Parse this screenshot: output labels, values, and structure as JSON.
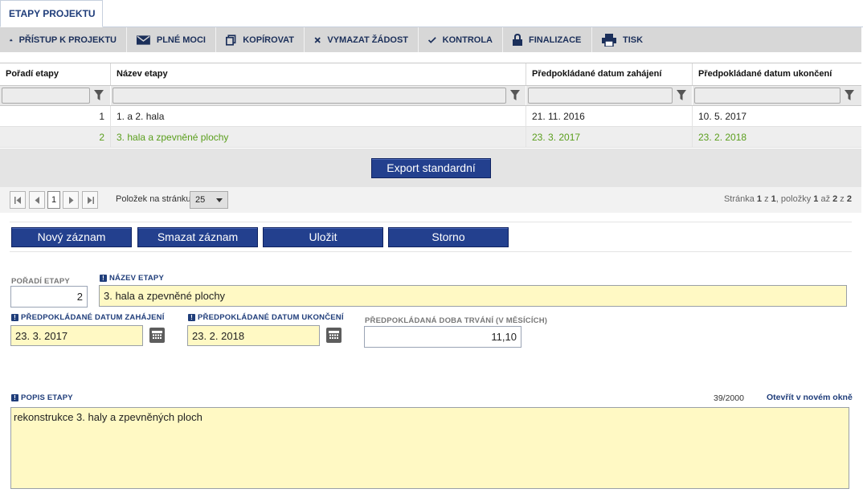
{
  "tab": {
    "title": "ETAPY PROJEKTU"
  },
  "toolbar": {
    "items": [
      {
        "label": "PŘÍSTUP K PROJEKTU",
        "icon": "people-icon"
      },
      {
        "label": "PLNÉ MOCI",
        "icon": "envelope-icon"
      },
      {
        "label": "KOPÍROVAT",
        "icon": "copy-icon"
      },
      {
        "label": "VYMAZAT ŽÁDOST",
        "icon": "cross-icon"
      },
      {
        "label": "KONTROLA",
        "icon": "check-icon"
      },
      {
        "label": "FINALIZACE",
        "icon": "lock-icon"
      },
      {
        "label": "TISK",
        "icon": "printer-icon"
      }
    ]
  },
  "grid": {
    "columns": [
      "Pořadí etapy",
      "Název etapy",
      "Předpokládané datum zahájení",
      "Předpokládané datum ukončení"
    ],
    "rows": [
      {
        "order": "1",
        "name": "1. a 2. hala",
        "start": "21. 11. 2016",
        "end": "10. 5. 2017"
      },
      {
        "order": "2",
        "name": "3. hala a zpevněné plochy",
        "start": "23. 3. 2017",
        "end": "23. 2. 2018"
      }
    ],
    "selected_color": "#5a9e1c",
    "export_label": "Export standardní"
  },
  "pager": {
    "current_page": "1",
    "page_size_label": "Položek na stránku",
    "page_size": "25",
    "info": {
      "prefix": "Stránka ",
      "page": "1",
      "of": " z ",
      "pages": "1",
      "items": ", položky ",
      "from": "1",
      "to_text": " až ",
      "to": "2",
      "z2": " z ",
      "total": "2"
    }
  },
  "actions": {
    "new": "Nový záznam",
    "delete": "Smazat záznam",
    "save": "Uložit",
    "cancel": "Storno"
  },
  "form": {
    "order_label": "POŘADÍ ETAPY",
    "order_value": "2",
    "name_label": "NÁZEV ETAPY",
    "name_value": "3. hala a zpevněné plochy",
    "start_label": "PŘEDPOKLÁDANÉ DATUM ZAHÁJENÍ",
    "start_value": "23. 3. 2017",
    "end_label": "PŘEDPOKLÁDANÉ DATUM UKONČENÍ",
    "end_value": "23. 2. 2018",
    "duration_label": "PŘEDPOKLÁDANÁ DOBA TRVÁNÍ (V MĚSÍCÍCH)",
    "duration_value": "11,10",
    "desc_label": "POPIS ETAPY",
    "desc_counter": "39/2000",
    "desc_open": "Otevřít v novém okně",
    "desc_value": "rekonstrukce 3. haly a zpevněných ploch",
    "required_mark": "!"
  },
  "colors": {
    "accent": "#23408e",
    "required_bg": "#fff9c4",
    "nav_text": "#1f3d7a"
  }
}
